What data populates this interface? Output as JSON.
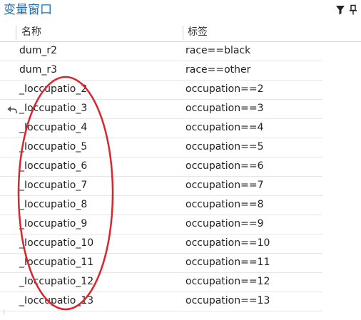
{
  "window": {
    "title": "变量窗口"
  },
  "toolbar": {
    "filter_icon": "filter-icon",
    "pin_icon": "pin-icon"
  },
  "table": {
    "columns": [
      "名称",
      "标签"
    ],
    "rows": [
      {
        "name": "dum_r2",
        "label": "race==black"
      },
      {
        "name": "dum_r3",
        "label": "race==other"
      },
      {
        "name": "_Ioccupatio_2",
        "label": "occupation==2"
      },
      {
        "name": "_Ioccupatio_3",
        "label": "occupation==3"
      },
      {
        "name": "_Ioccupatio_4",
        "label": "occupation==4"
      },
      {
        "name": "_Ioccupatio_5",
        "label": "occupation==5"
      },
      {
        "name": "_Ioccupatio_6",
        "label": "occupation==6"
      },
      {
        "name": "_Ioccupatio_7",
        "label": "occupation==7"
      },
      {
        "name": "_Ioccupatio_8",
        "label": "occupation==8"
      },
      {
        "name": "_Ioccupatio_9",
        "label": "occupation==9"
      },
      {
        "name": "_Ioccupatio_10",
        "label": "occupation==10"
      },
      {
        "name": "_Ioccupatio_11",
        "label": "occupation==11"
      },
      {
        "name": "_Ioccupatio_12",
        "label": "occupation==12"
      },
      {
        "name": "_Ioccupatio_13",
        "label": "occupation==13"
      }
    ],
    "marked_row_icon": "return-arrow-icon"
  },
  "annotation": {
    "shape": "ellipse",
    "color": "#d9262e"
  },
  "colors": {
    "title": "#1f6fb5",
    "annotation": "#d9262e"
  }
}
